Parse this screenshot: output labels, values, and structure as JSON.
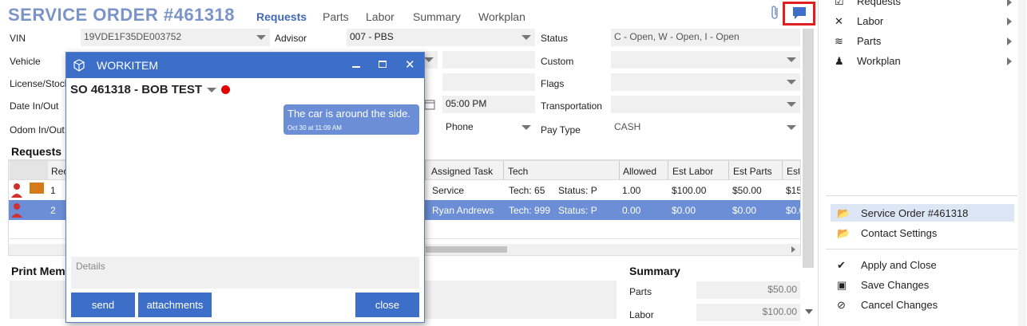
{
  "header": {
    "title": "SERVICE ORDER #461318",
    "tabs": [
      "Requests",
      "Parts",
      "Labor",
      "Summary",
      "Workplan"
    ]
  },
  "form": {
    "vin_label": "VIN",
    "vin_value": "19VDE1F35DE003752",
    "advisor_label": "Advisor",
    "advisor_value": "007 - PBS",
    "status_label": "Status",
    "status_value": "C - Open, W - Open, I - Open",
    "vehicle_label": "Vehicle",
    "custom_label": "Custom",
    "license_label": "License/Stock",
    "flags_label": "Flags",
    "datein_label": "Date In/Out",
    "time_value": "05:00 PM",
    "transport_label": "Transportation",
    "odom_label": "Odom In/Out",
    "contact_value": "Phone",
    "paytype_label": "Pay Type",
    "paytype_value": "CASH"
  },
  "requests": {
    "section_title": "Requests",
    "col_req": "Rec",
    "headers": [
      "Assigned Task",
      "Tech",
      "Allowed",
      "Est Labor",
      "Est Parts",
      "Est"
    ],
    "rows": [
      {
        "num": "1",
        "task": "Service",
        "tech": "Tech: 65",
        "status": "Status: P",
        "allowed": "1.00",
        "est_labor": "$100.00",
        "est_parts": "$50.00",
        "est": "$15"
      },
      {
        "num": "2",
        "task": "Ryan Andrews",
        "tech": "Tech: 999",
        "status": "Status: P",
        "allowed": "0.00",
        "est_labor": "$0.00",
        "est_parts": "$0.00",
        "est": "$0.0"
      }
    ]
  },
  "print_memo": {
    "label": "Print Mem"
  },
  "summary": {
    "title": "Summary",
    "parts_label": "Parts",
    "parts_value": "$50.00",
    "labor_label": "Labor",
    "labor_value": "$100.00"
  },
  "side_menu": {
    "top_items": [
      "Requests",
      "Labor",
      "Parts",
      "Workplan"
    ],
    "bottom_items": [
      "Service Order #461318",
      "Contact Settings"
    ],
    "actions": [
      "Apply and Close",
      "Save Changes",
      "Cancel Changes"
    ]
  },
  "workitem": {
    "title": "WORKITEM",
    "so_label": "SO 461318 - BOB TEST",
    "message": "The car is around the side.",
    "message_time": "Oct 30 at 11:09 AM",
    "details_placeholder": "Details",
    "send": "send",
    "attachments": "attachments",
    "close": "close"
  },
  "colors": {
    "accent": "#3d6fc8",
    "title": "#7a93c8",
    "selected_row": "#6b8ed6",
    "status_dot": "#e00000",
    "highlight_box": "#e02020"
  }
}
